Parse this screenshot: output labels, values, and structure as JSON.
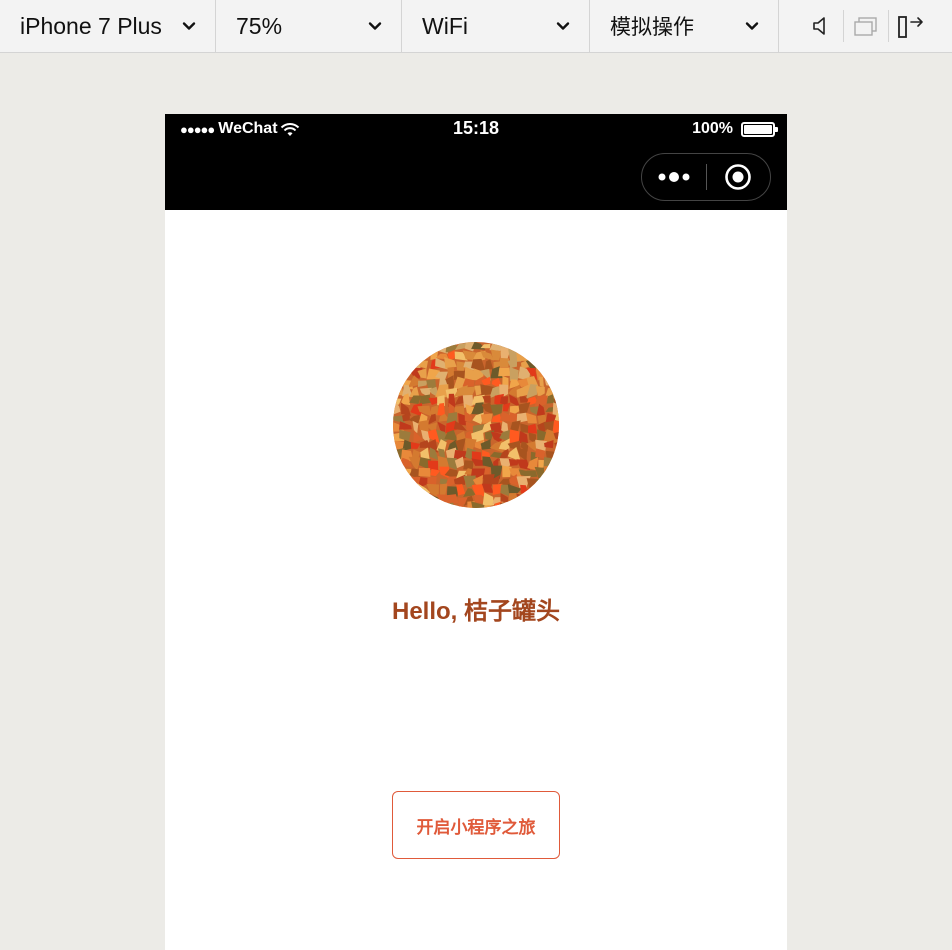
{
  "toolbar": {
    "device": "iPhone 7 Plus",
    "zoom": "75%",
    "network": "WiFi",
    "operation": "模拟操作",
    "icons": [
      "volume-icon",
      "screenshot-window-icon",
      "detach-window-icon"
    ]
  },
  "statusbar": {
    "signal": "●●●●●",
    "carrier": "WeChat",
    "time": "15:18",
    "battery": "100%"
  },
  "page": {
    "greeting": "Hello, 桔子罐头",
    "start_button": "开启小程序之旅"
  },
  "colors": {
    "greeting": "#a3461e",
    "button_accent": "#e05a3a",
    "background": "#ecebe7"
  }
}
